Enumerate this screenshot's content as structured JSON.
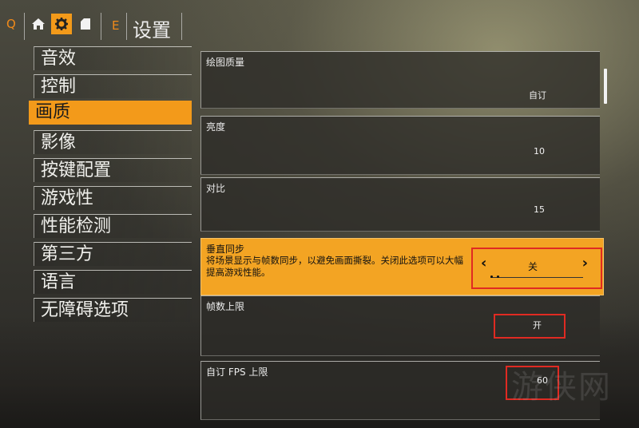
{
  "topbar": {
    "left_key": "Q",
    "right_key": "E",
    "title": "设置",
    "icons": [
      "home-icon",
      "gear-icon",
      "save-icon"
    ]
  },
  "menu": {
    "items": [
      {
        "label": "音效"
      },
      {
        "label": "控制"
      },
      {
        "label": "画质",
        "active": true
      },
      {
        "label": "影像"
      },
      {
        "label": "按键配置"
      },
      {
        "label": "游戏性"
      },
      {
        "label": "性能检测"
      },
      {
        "label": "第三方"
      },
      {
        "label": "语言"
      },
      {
        "label": "无障碍选项"
      }
    ]
  },
  "settings": {
    "quality": {
      "label": "绘图质量",
      "value": "自订"
    },
    "brightness": {
      "label": "亮度",
      "value": "10"
    },
    "contrast": {
      "label": "对比",
      "value": "15"
    },
    "vsync": {
      "label": "垂直同步",
      "description": "将场景显示与帧数同步，以避免画面撕裂。关闭此选项可以大幅提高游戏性能。",
      "value": "关"
    },
    "fps_limit": {
      "label": "帧数上限",
      "value": "开"
    },
    "custom_fps": {
      "label": "自订 FPS 上限",
      "value": "60"
    }
  },
  "watermark": "游侠网",
  "colors": {
    "accent": "#f39a1a",
    "highlight": "#e02a22"
  }
}
